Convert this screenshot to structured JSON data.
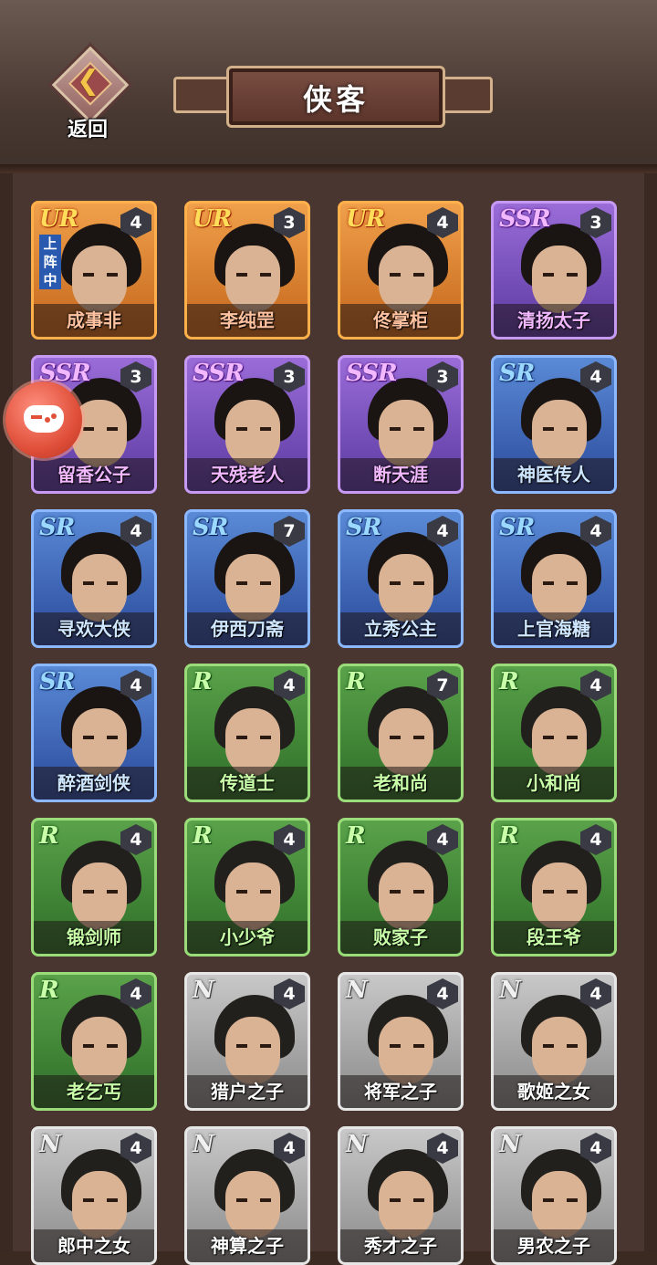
{
  "header": {
    "back_label": "返回",
    "back_icon": "chevron-left-icon",
    "title": "侠客"
  },
  "overlay": {
    "icon": "gamepad-icon"
  },
  "heroes": [
    {
      "rarity": "UR",
      "level": "4",
      "name": "成事非",
      "tag": "上阵中"
    },
    {
      "rarity": "UR",
      "level": "3",
      "name": "李纯罡",
      "tag": ""
    },
    {
      "rarity": "UR",
      "level": "4",
      "name": "佟掌柜",
      "tag": ""
    },
    {
      "rarity": "SSR",
      "level": "3",
      "name": "清扬太子",
      "tag": ""
    },
    {
      "rarity": "SSR",
      "level": "3",
      "name": "留香公子",
      "tag": ""
    },
    {
      "rarity": "SSR",
      "level": "3",
      "name": "天残老人",
      "tag": ""
    },
    {
      "rarity": "SSR",
      "level": "3",
      "name": "断天涯",
      "tag": ""
    },
    {
      "rarity": "SR",
      "level": "4",
      "name": "神医传人",
      "tag": ""
    },
    {
      "rarity": "SR",
      "level": "4",
      "name": "寻欢大侠",
      "tag": ""
    },
    {
      "rarity": "SR",
      "level": "7",
      "name": "伊西刀斋",
      "tag": ""
    },
    {
      "rarity": "SR",
      "level": "4",
      "name": "立秀公主",
      "tag": ""
    },
    {
      "rarity": "SR",
      "level": "4",
      "name": "上官海糖",
      "tag": ""
    },
    {
      "rarity": "SR",
      "level": "4",
      "name": "醉酒剑侠",
      "tag": ""
    },
    {
      "rarity": "R",
      "level": "4",
      "name": "传道士",
      "tag": ""
    },
    {
      "rarity": "R",
      "level": "7",
      "name": "老和尚",
      "tag": ""
    },
    {
      "rarity": "R",
      "level": "4",
      "name": "小和尚",
      "tag": ""
    },
    {
      "rarity": "R",
      "level": "4",
      "name": "锻剑师",
      "tag": ""
    },
    {
      "rarity": "R",
      "level": "4",
      "name": "小少爷",
      "tag": ""
    },
    {
      "rarity": "R",
      "level": "4",
      "name": "败家子",
      "tag": ""
    },
    {
      "rarity": "R",
      "level": "4",
      "name": "段王爷",
      "tag": ""
    },
    {
      "rarity": "R",
      "level": "4",
      "name": "老乞丐",
      "tag": ""
    },
    {
      "rarity": "N",
      "level": "4",
      "name": "猎户之子",
      "tag": ""
    },
    {
      "rarity": "N",
      "level": "4",
      "name": "将军之子",
      "tag": ""
    },
    {
      "rarity": "N",
      "level": "4",
      "name": "歌姬之女",
      "tag": ""
    },
    {
      "rarity": "N",
      "level": "4",
      "name": "郎中之女",
      "tag": ""
    },
    {
      "rarity": "N",
      "level": "4",
      "name": "神算之子",
      "tag": ""
    },
    {
      "rarity": "N",
      "level": "4",
      "name": "秀才之子",
      "tag": ""
    },
    {
      "rarity": "N",
      "level": "4",
      "name": "男农之子",
      "tag": ""
    }
  ]
}
